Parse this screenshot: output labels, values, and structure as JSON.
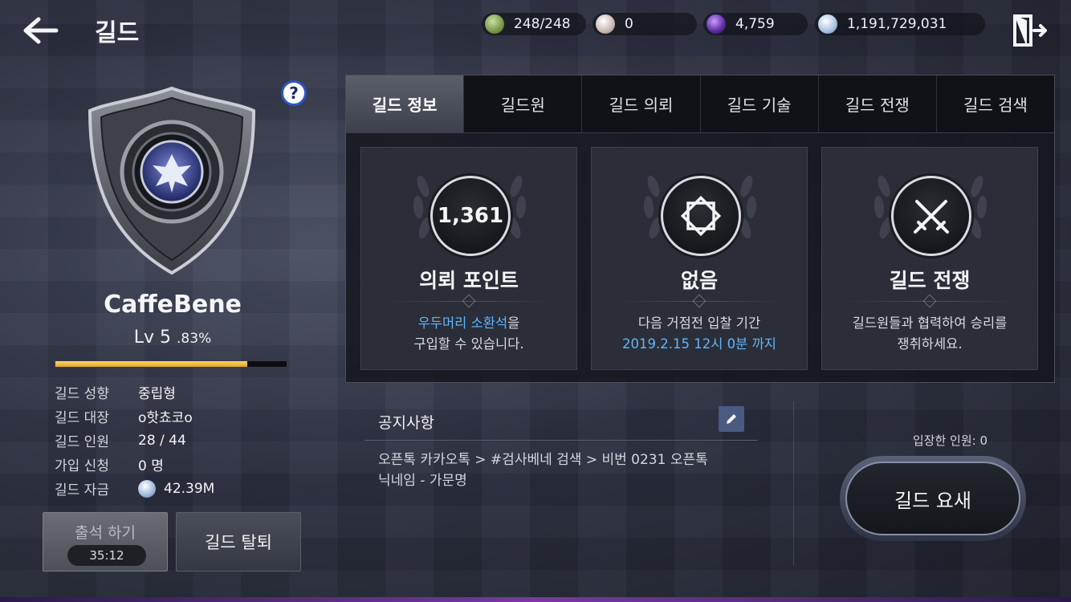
{
  "header": {
    "title": "길드",
    "currencies": {
      "stamina": "248/248",
      "pearl": "0",
      "crystal": "4,759",
      "silver": "1,191,729,031"
    }
  },
  "guild": {
    "name": "CaffeBene",
    "level": "Lv 5",
    "level_pct": ".83%",
    "xp_fraction": 0.83,
    "info": [
      {
        "key": "길드 성향",
        "value": "중립형"
      },
      {
        "key": "길드 대장",
        "value": "o핫쵸코o"
      },
      {
        "key": "길드 인원",
        "value": "28 / 44"
      },
      {
        "key": "가입 신청",
        "value": "0 명"
      },
      {
        "key": "길드 자금",
        "value": "42.39M"
      }
    ],
    "attend_label": "출석 하기",
    "attend_timer": "35:12",
    "leave_label": "길드 탈퇴"
  },
  "tabs": [
    "길드 정보",
    "길드원",
    "길드 의뢰",
    "길드 기술",
    "길드 전쟁",
    "길드 검색"
  ],
  "cards": [
    {
      "medal_value": "1,361",
      "title": "의뢰 포인트",
      "desc_hl": "우두머리 소환석",
      "desc_1": "을",
      "desc_2": "구입할 수 있습니다."
    },
    {
      "title": "없음",
      "desc_1": "다음 거점전 입찰 기간",
      "desc_hl": "2019.2.15 12시 0분 까지"
    },
    {
      "title": "길드 전쟁",
      "desc_1": "길드원들과 협력하여 승리를",
      "desc_2": "쟁취하세요."
    }
  ],
  "notice": {
    "title": "공지사항",
    "line_1": "오픈톡 카카오톡 > #검사베네 검색 > 비번 0231 오픈톡",
    "line_2": "닉네임 - 가문명"
  },
  "fort": {
    "entered": "입장한 인원: 0",
    "button": "길드 요새"
  },
  "colors": {
    "highlight": "#5fb6ff",
    "xp_fill": "#e0a82e"
  }
}
